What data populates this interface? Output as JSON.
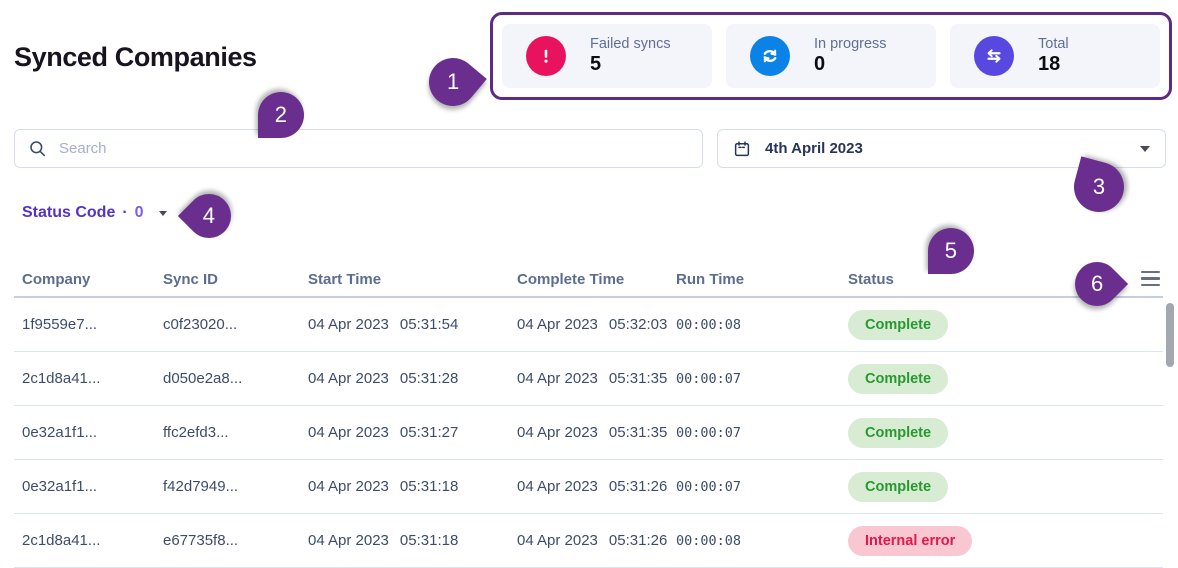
{
  "page": {
    "title": "Synced Companies"
  },
  "stats": {
    "border_color": "#5e2b84",
    "cards": [
      {
        "label": "Failed syncs",
        "value": "5",
        "icon": "alert-icon",
        "icon_color": "#e8135c"
      },
      {
        "label": "In progress",
        "value": "0",
        "icon": "sync-icon",
        "icon_color": "#0b82e6"
      },
      {
        "label": "Total",
        "value": "18",
        "icon": "transfer-icon",
        "icon_color": "#5948e0"
      }
    ]
  },
  "search": {
    "placeholder": "Search",
    "icon": "search-icon"
  },
  "date_picker": {
    "value": "4th April 2023",
    "icon": "calendar-icon"
  },
  "status_filter": {
    "label": "Status Code",
    "separator": "·",
    "count": "0"
  },
  "annotations": {
    "color": "#6a2f8e",
    "markers": [
      "1",
      "2",
      "3",
      "4",
      "5",
      "6"
    ]
  },
  "table": {
    "columns": [
      "Company",
      "Sync ID",
      "Start Time",
      "Complete Time",
      "Run Time",
      "Status"
    ],
    "rows": [
      {
        "company": "1f9559e7...",
        "sync_id": "c0f23020...",
        "start_date": "04 Apr 2023",
        "start_time": "05:31:54",
        "complete_date": "04 Apr 2023",
        "complete_time": "05:32:03",
        "run_time": "00:00:08",
        "status": "Complete",
        "status_type": "success"
      },
      {
        "company": "2c1d8a41...",
        "sync_id": "d050e2a8...",
        "start_date": "04 Apr 2023",
        "start_time": "05:31:28",
        "complete_date": "04 Apr 2023",
        "complete_time": "05:31:35",
        "run_time": "00:00:07",
        "status": "Complete",
        "status_type": "success"
      },
      {
        "company": "0e32a1f1...",
        "sync_id": "ffc2efd3...",
        "start_date": "04 Apr 2023",
        "start_time": "05:31:27",
        "complete_date": "04 Apr 2023",
        "complete_time": "05:31:35",
        "run_time": "00:00:07",
        "status": "Complete",
        "status_type": "success"
      },
      {
        "company": "0e32a1f1...",
        "sync_id": "f42d7949...",
        "start_date": "04 Apr 2023",
        "start_time": "05:31:18",
        "complete_date": "04 Apr 2023",
        "complete_time": "05:31:26",
        "run_time": "00:00:07",
        "status": "Complete",
        "status_type": "success"
      },
      {
        "company": "2c1d8a41...",
        "sync_id": "e67735f8...",
        "start_date": "04 Apr 2023",
        "start_time": "05:31:18",
        "complete_date": "04 Apr 2023",
        "complete_time": "05:31:26",
        "run_time": "00:00:08",
        "status": "Internal error",
        "status_type": "error"
      }
    ]
  },
  "colors": {
    "success_text": "#27992f",
    "success_bg": "#d8ecd4",
    "error_text": "#e3174a",
    "error_bg": "#f9c7d2",
    "link_purple": "#5531cc",
    "header_text": "#5c6d8f"
  }
}
